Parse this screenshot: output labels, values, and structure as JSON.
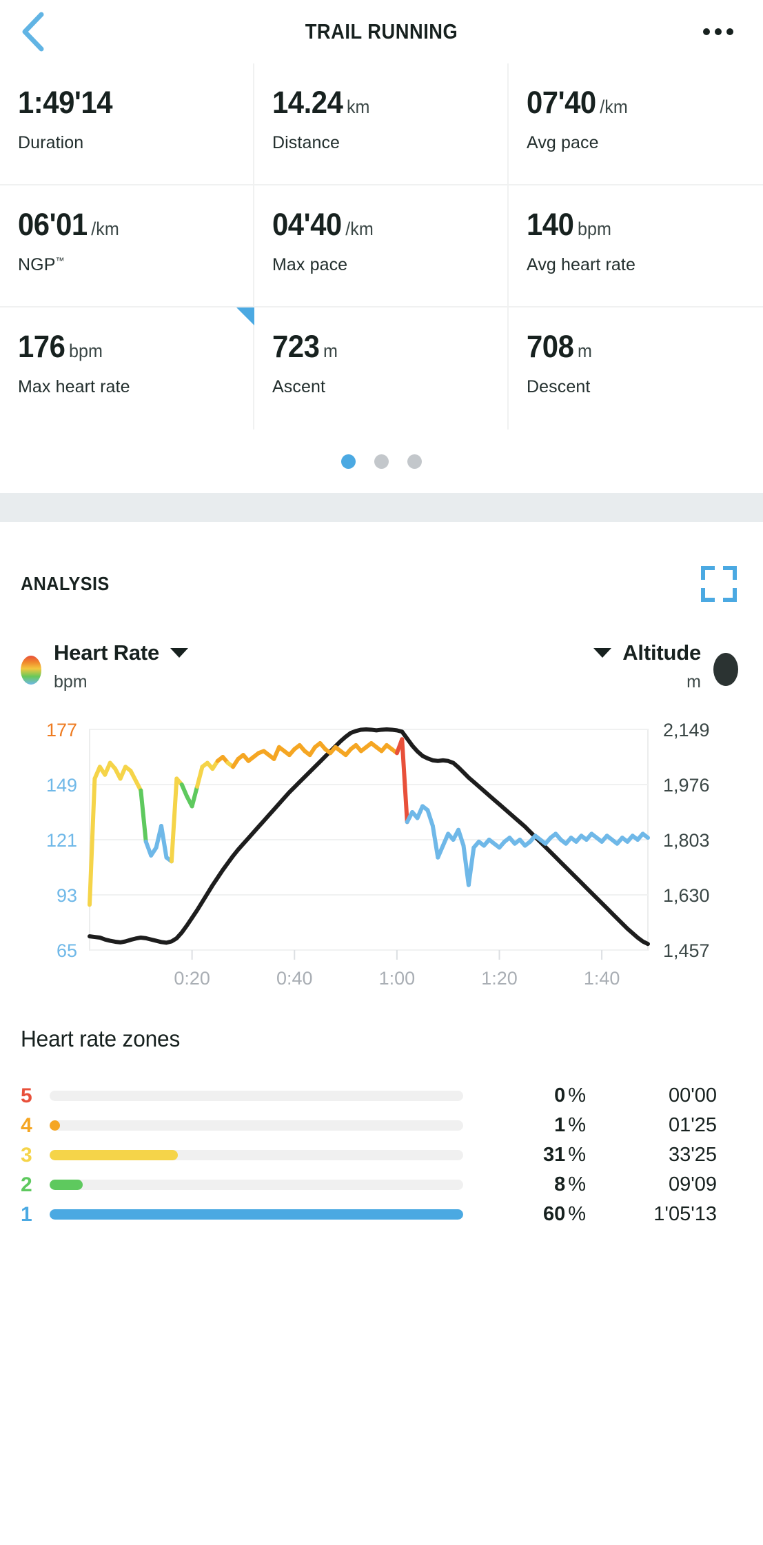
{
  "header": {
    "title": "TRAIL RUNNING",
    "back_icon": "chevron-left-icon",
    "more_icon": "overflow-menu-icon",
    "accent_color": "#4ba9e2"
  },
  "stats": [
    {
      "value": "1:49'14",
      "unit": "",
      "label": "Duration"
    },
    {
      "value": "14.24",
      "unit": "km",
      "label": "Distance"
    },
    {
      "value": "07'40",
      "unit": "/km",
      "label": "Avg pace"
    },
    {
      "value": "06'01",
      "unit": "/km",
      "label": "NGP",
      "label_sup": "™"
    },
    {
      "value": "04'40",
      "unit": "/km",
      "label": "Max pace"
    },
    {
      "value": "140",
      "unit": "bpm",
      "label": "Avg heart rate"
    },
    {
      "value": "176",
      "unit": "bpm",
      "label": "Max heart rate"
    },
    {
      "value": "723",
      "unit": "m",
      "label": "Ascent"
    },
    {
      "value": "708",
      "unit": "m",
      "label": "Descent"
    }
  ],
  "pager": {
    "count": 3,
    "active_index": 0
  },
  "analysis": {
    "title": "ANALYSIS",
    "expand_icon": "expand-fullscreen-icon",
    "left_metric": {
      "name": "Heart Rate",
      "unit": "bpm",
      "swatch": "hr-gradient-dot"
    },
    "right_metric": {
      "name": "Altitude",
      "unit": "m",
      "swatch": "altitude-dot"
    }
  },
  "chart_data": {
    "type": "line",
    "title": "Heart Rate and Altitude over elapsed time",
    "xlabel": "",
    "x_ticks": [
      "0:20",
      "0:40",
      "1:00",
      "1:20",
      "1:40"
    ],
    "x_tick_values": [
      20,
      40,
      60,
      80,
      100
    ],
    "xlim": [
      0,
      109
    ],
    "grid": true,
    "legend_position": "top",
    "series": [
      {
        "name": "Heart Rate",
        "unit": "bpm",
        "axis": "left",
        "ylabel": "bpm",
        "ylim": [
          65,
          177
        ],
        "y_ticks": [
          65,
          93,
          121,
          149,
          177
        ],
        "tick_colors": [
          "#6fb8e8",
          "#6fb8e8",
          "#6fb8e8",
          "#6fb8e8",
          "#ee7b21"
        ],
        "zone_colors": {
          "1": "#6fb8e8",
          "2": "#5ec95e",
          "3": "#f5d449",
          "4": "#f5a623",
          "5": "#e8503a"
        },
        "x": [
          0,
          1,
          2,
          3,
          4,
          5,
          6,
          7,
          8,
          9,
          10,
          11,
          12,
          13,
          14,
          15,
          16,
          17,
          18,
          19,
          20,
          21,
          22,
          23,
          24,
          25,
          26,
          27,
          28,
          29,
          30,
          31,
          32,
          33,
          34,
          35,
          36,
          37,
          38,
          39,
          40,
          41,
          42,
          43,
          44,
          45,
          46,
          47,
          48,
          49,
          50,
          51,
          52,
          53,
          54,
          55,
          56,
          57,
          58,
          59,
          60,
          61,
          62,
          63,
          64,
          65,
          66,
          67,
          68,
          69,
          70,
          71,
          72,
          73,
          74,
          75,
          76,
          77,
          78,
          79,
          80,
          81,
          82,
          83,
          84,
          85,
          86,
          87,
          88,
          89,
          90,
          91,
          92,
          93,
          94,
          95,
          96,
          97,
          98,
          99,
          100,
          101,
          102,
          103,
          104,
          105,
          106,
          107,
          108,
          109
        ],
        "values": [
          88,
          152,
          158,
          154,
          160,
          157,
          152,
          158,
          156,
          151,
          146,
          120,
          113,
          117,
          128,
          112,
          110,
          152,
          149,
          143,
          138,
          148,
          158,
          160,
          157,
          161,
          163,
          160,
          158,
          162,
          164,
          161,
          163,
          165,
          166,
          164,
          162,
          168,
          166,
          164,
          167,
          169,
          166,
          164,
          168,
          170,
          167,
          165,
          168,
          166,
          164,
          167,
          169,
          166,
          168,
          170,
          168,
          166,
          169,
          167,
          165,
          172,
          130,
          135,
          132,
          138,
          136,
          128,
          112,
          118,
          124,
          121,
          126,
          118,
          98,
          117,
          120,
          118,
          121,
          119,
          117,
          120,
          122,
          119,
          121,
          118,
          120,
          123,
          121,
          119,
          122,
          124,
          121,
          119,
          122,
          120,
          123,
          121,
          124,
          122,
          120,
          123,
          121,
          119,
          122,
          120,
          123,
          121,
          124,
          122
        ]
      },
      {
        "name": "Altitude",
        "unit": "m",
        "axis": "right",
        "ylabel": "m",
        "ylim": [
          1457,
          2149
        ],
        "y_ticks": [
          1457,
          1630,
          1803,
          1976,
          2149
        ],
        "color": "#1d1d1d",
        "x": [
          0,
          1,
          2,
          3,
          4,
          5,
          6,
          7,
          8,
          9,
          10,
          11,
          12,
          13,
          14,
          15,
          16,
          17,
          18,
          19,
          20,
          21,
          22,
          23,
          24,
          25,
          26,
          27,
          28,
          29,
          30,
          31,
          32,
          33,
          34,
          35,
          36,
          37,
          38,
          39,
          40,
          41,
          42,
          43,
          44,
          45,
          46,
          47,
          48,
          49,
          50,
          51,
          52,
          53,
          54,
          55,
          56,
          57,
          58,
          59,
          60,
          61,
          62,
          63,
          64,
          65,
          66,
          67,
          68,
          69,
          70,
          71,
          72,
          73,
          74,
          75,
          76,
          77,
          78,
          79,
          80,
          81,
          82,
          83,
          84,
          85,
          86,
          87,
          88,
          89,
          90,
          91,
          92,
          93,
          94,
          95,
          96,
          97,
          98,
          99,
          100,
          101,
          102,
          103,
          104,
          105,
          106,
          107,
          108,
          109
        ],
        "values": [
          1500,
          1498,
          1496,
          1490,
          1486,
          1483,
          1481,
          1484,
          1489,
          1493,
          1496,
          1494,
          1490,
          1486,
          1482,
          1480,
          1484,
          1494,
          1512,
          1534,
          1558,
          1582,
          1608,
          1634,
          1660,
          1684,
          1708,
          1730,
          1752,
          1772,
          1790,
          1808,
          1826,
          1844,
          1862,
          1880,
          1898,
          1916,
          1934,
          1952,
          1968,
          1984,
          2000,
          2016,
          2032,
          2048,
          2064,
          2080,
          2096,
          2112,
          2126,
          2138,
          2144,
          2148,
          2149,
          2148,
          2146,
          2148,
          2149,
          2148,
          2146,
          2142,
          2120,
          2098,
          2080,
          2066,
          2058,
          2052,
          2050,
          2052,
          2050,
          2044,
          2030,
          2014,
          1998,
          1984,
          1970,
          1956,
          1942,
          1928,
          1914,
          1900,
          1886,
          1872,
          1858,
          1844,
          1828,
          1812,
          1796,
          1780,
          1764,
          1748,
          1732,
          1716,
          1700,
          1684,
          1668,
          1652,
          1636,
          1620,
          1604,
          1588,
          1572,
          1556,
          1540,
          1524,
          1510,
          1496,
          1484,
          1476
        ]
      }
    ]
  },
  "zones_section": {
    "title": "Heart rate zones",
    "track_color": "#f0f0f0",
    "rows": [
      {
        "zone": "5",
        "color": "#e8503a",
        "percent": "0",
        "percent_sign": "%",
        "time": "00'00",
        "fill_pct": 0
      },
      {
        "zone": "4",
        "color": "#f5a623",
        "percent": "1",
        "percent_sign": "%",
        "time": "01'25",
        "fill_pct": 1
      },
      {
        "zone": "3",
        "color": "#f5d449",
        "percent": "31",
        "percent_sign": "%",
        "time": "33'25",
        "fill_pct": 31
      },
      {
        "zone": "2",
        "color": "#5ec95e",
        "percent": "8",
        "percent_sign": "%",
        "time": "09'09",
        "fill_pct": 8
      },
      {
        "zone": "1",
        "color": "#4ba9e2",
        "percent": "60",
        "percent_sign": "%",
        "time": "1'05'13",
        "fill_pct": 100
      }
    ]
  }
}
